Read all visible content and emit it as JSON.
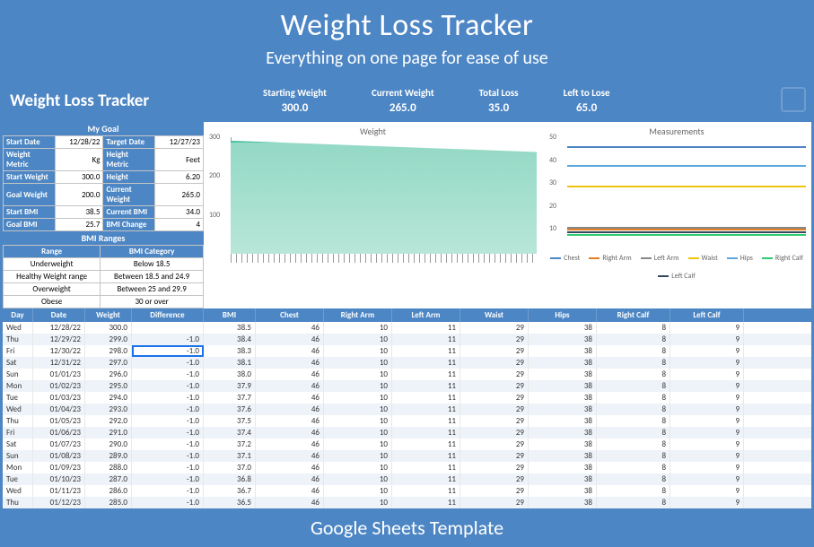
{
  "banner": {
    "title": "Weight Loss Tracker",
    "subtitle": "Everything on one page for ease of use",
    "footer": "Google Sheets Template"
  },
  "header": {
    "title": "Weight Loss Tracker",
    "stats": [
      {
        "label": "Starting Weight",
        "value": "300.0"
      },
      {
        "label": "Current Weight",
        "value": "265.0"
      },
      {
        "label": "Total Loss",
        "value": "35.0"
      },
      {
        "label": "Left to Lose",
        "value": "65.0"
      }
    ]
  },
  "goal": {
    "title": "My Goal",
    "rows": [
      [
        "Start Date",
        "12/28/22",
        "Target Date",
        "12/27/23"
      ],
      [
        "Weight Metric",
        "Kg",
        "Height Metric",
        "Feet"
      ],
      [
        "Start Weight",
        "300.0",
        "Height",
        "6.20"
      ],
      [
        "Goal Weight",
        "200.0",
        "Current Weight",
        "265.0"
      ],
      [
        "Start BMI",
        "38.5",
        "Current BMI",
        "34.0"
      ],
      [
        "Goal BMI",
        "25.7",
        "BMI Change",
        "4"
      ]
    ]
  },
  "bmi": {
    "title": "BMI Ranges",
    "headers": [
      "Range",
      "BMI Category"
    ],
    "rows": [
      [
        "Underweight",
        "Below 18.5"
      ],
      [
        "Healthy Weight range",
        "Between 18.5 and 24.9"
      ],
      [
        "Overweight",
        "Between 25 and 29.9"
      ],
      [
        "Obese",
        "30 or over"
      ]
    ]
  },
  "charts": {
    "weight_title": "Weight",
    "meas_title": "Measurements",
    "legend": [
      {
        "name": "Chest",
        "color": "#4d86c4"
      },
      {
        "name": "Right Arm",
        "color": "#e67e22"
      },
      {
        "name": "Left Arm",
        "color": "#888"
      },
      {
        "name": "Waist",
        "color": "#f1c40f"
      },
      {
        "name": "Hips",
        "color": "#5aa8dd"
      },
      {
        "name": "Right Calf",
        "color": "#2ecc71"
      },
      {
        "name": "Left Calf",
        "color": "#34495e"
      }
    ]
  },
  "chart_data": {
    "weight": {
      "type": "area",
      "ylim": [
        0,
        300
      ],
      "yticks": [
        100,
        200,
        300
      ],
      "series": [
        {
          "name": "Weight",
          "start": 300,
          "end": 265,
          "n": 36
        }
      ]
    },
    "measurements": {
      "type": "line",
      "ylim": [
        0,
        50
      ],
      "yticks": [
        10,
        20,
        30,
        40,
        50
      ],
      "series": [
        {
          "name": "Chest",
          "value": 46,
          "color": "#4d86c4"
        },
        {
          "name": "Right Arm",
          "value": 10,
          "color": "#e67e22"
        },
        {
          "name": "Left Arm",
          "value": 11,
          "color": "#888"
        },
        {
          "name": "Waist",
          "value": 29,
          "color": "#f1c40f"
        },
        {
          "name": "Hips",
          "value": 38,
          "color": "#5aa8dd"
        },
        {
          "name": "Right Calf",
          "value": 8,
          "color": "#2ecc71"
        },
        {
          "name": "Left Calf",
          "value": 9,
          "color": "#34495e"
        }
      ]
    }
  },
  "table": {
    "headers": [
      "Day",
      "Date",
      "Weight",
      "Difference",
      "BMI",
      "Chest",
      "Right Arm",
      "Left Arm",
      "Waist",
      "Hips",
      "Right Calf",
      "Left Calf"
    ],
    "rows": [
      [
        "Wed",
        "12/28/22",
        "300.0",
        "",
        "38.5",
        "46",
        "10",
        "11",
        "29",
        "38",
        "8",
        "9"
      ],
      [
        "Thu",
        "12/29/22",
        "299.0",
        "-1.0",
        "38.4",
        "46",
        "10",
        "11",
        "29",
        "38",
        "8",
        "9"
      ],
      [
        "Fri",
        "12/30/22",
        "298.0",
        "-1.0",
        "38.3",
        "46",
        "10",
        "11",
        "29",
        "38",
        "8",
        "9"
      ],
      [
        "Sat",
        "12/31/22",
        "297.0",
        "-1.0",
        "38.1",
        "46",
        "10",
        "11",
        "29",
        "38",
        "8",
        "9"
      ],
      [
        "Sun",
        "01/01/23",
        "296.0",
        "-1.0",
        "38.0",
        "46",
        "10",
        "11",
        "29",
        "38",
        "8",
        "9"
      ],
      [
        "Mon",
        "01/02/23",
        "295.0",
        "-1.0",
        "37.9",
        "46",
        "10",
        "11",
        "29",
        "38",
        "8",
        "9"
      ],
      [
        "Tue",
        "01/03/23",
        "294.0",
        "-1.0",
        "37.7",
        "46",
        "10",
        "11",
        "29",
        "38",
        "8",
        "9"
      ],
      [
        "Wed",
        "01/04/23",
        "293.0",
        "-1.0",
        "37.6",
        "46",
        "10",
        "11",
        "29",
        "38",
        "8",
        "9"
      ],
      [
        "Thu",
        "01/05/23",
        "292.0",
        "-1.0",
        "37.5",
        "46",
        "10",
        "11",
        "29",
        "38",
        "8",
        "9"
      ],
      [
        "Fri",
        "01/06/23",
        "291.0",
        "-1.0",
        "37.4",
        "46",
        "10",
        "11",
        "29",
        "38",
        "8",
        "9"
      ],
      [
        "Sat",
        "01/07/23",
        "290.0",
        "-1.0",
        "37.2",
        "46",
        "10",
        "11",
        "29",
        "38",
        "8",
        "9"
      ],
      [
        "Sun",
        "01/08/23",
        "289.0",
        "-1.0",
        "37.1",
        "46",
        "10",
        "11",
        "29",
        "38",
        "8",
        "9"
      ],
      [
        "Mon",
        "01/09/23",
        "288.0",
        "-1.0",
        "37.0",
        "46",
        "10",
        "11",
        "29",
        "38",
        "8",
        "9"
      ],
      [
        "Tue",
        "01/10/23",
        "287.0",
        "-1.0",
        "36.8",
        "46",
        "10",
        "11",
        "29",
        "38",
        "8",
        "9"
      ],
      [
        "Wed",
        "01/11/23",
        "286.0",
        "-1.0",
        "36.7",
        "46",
        "10",
        "11",
        "29",
        "38",
        "8",
        "9"
      ],
      [
        "Thu",
        "01/12/23",
        "285.0",
        "-1.0",
        "36.5",
        "46",
        "10",
        "11",
        "29",
        "38",
        "8",
        "9"
      ]
    ]
  }
}
